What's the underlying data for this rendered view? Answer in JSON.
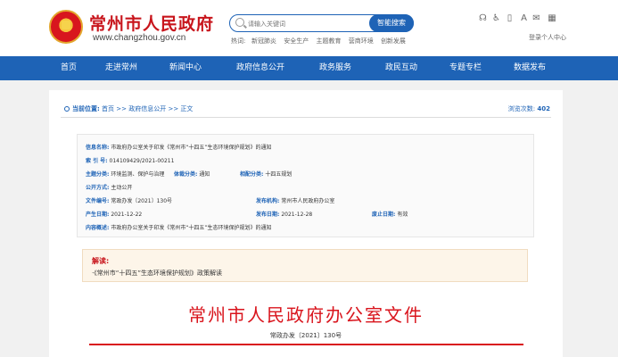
{
  "header": {
    "site_title": "常州市人民政府",
    "site_url": "www.changzhou.gov.cn",
    "search": {
      "placeholder": "请输入关键词",
      "button_label": "智能搜索"
    },
    "hot_label": "热词:",
    "hot_links": [
      "新冠肺炎",
      "安全生产",
      "主题教育",
      "营商环境",
      "创新发展"
    ],
    "util_icons": [
      "accessibility-icon",
      "wheelchair-icon",
      "mobile-icon",
      "font-size-icon",
      "mail-icon",
      "qrcode-icon"
    ],
    "login_text": "登录个人中心"
  },
  "nav": {
    "items": [
      "首页",
      "走进常州",
      "新闻中心",
      "政府信息公开",
      "政务服务",
      "政民互动",
      "专题专栏",
      "数据发布"
    ]
  },
  "location": {
    "label": "当前位置:",
    "path": "首页 >> 政府信息公开 >> 正文",
    "views_label": "浏览次数:",
    "views_count": "402"
  },
  "meta": {
    "info_name_key": "信息名称:",
    "info_name": "市政府办公室关于印发《常州市“十四五”生态环境保护规划》的通知",
    "index_key": "索 引 号:",
    "index": "014109429/2021-00211",
    "topic_key": "主题分类:",
    "topic": "环境监测、保护与治理",
    "genre_key": "体裁分类:",
    "genre": "通知",
    "related_key": "相配分类:",
    "related": "十四五规划",
    "open_key": "公开方式:",
    "open": "主动公开",
    "docno_key": "文件编号:",
    "docno": "常政办发〔2021〕130号",
    "issuer_key": "发布机构:",
    "issuer": "常州市人民政府办公室",
    "created_key": "产生日期:",
    "created": "2021-12-22",
    "published_key": "发布日期:",
    "published": "2021-12-28",
    "expire_key": "废止日期:",
    "expire": "有效",
    "summary_key": "内容概述:",
    "summary": "市政府办公室关于印发《常州市“十四五”生态环境保护规划》的通知"
  },
  "jiedu": {
    "title": "解读:",
    "link": "·《常州市“十四五”生态环境保护规划》政策解读"
  },
  "document": {
    "title": "常州市人民政府办公室文件",
    "number": "常政办发〔2021〕130号"
  }
}
